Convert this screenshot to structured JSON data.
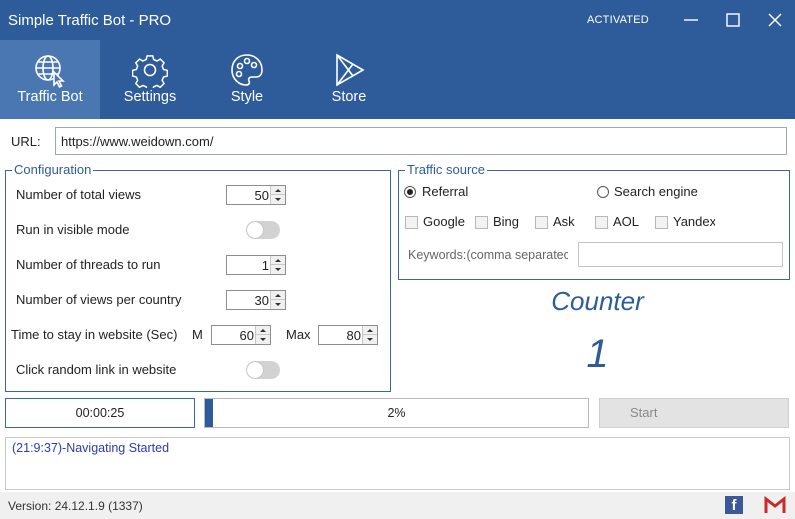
{
  "window": {
    "title": "Simple Traffic Bot - PRO",
    "status": "ACTIVATED",
    "controls": [
      "minimize-icon",
      "maximize-icon",
      "close-icon"
    ]
  },
  "nav": {
    "tabs": [
      {
        "label": "Traffic Bot",
        "icon": "globe-cursor-icon",
        "active": true
      },
      {
        "label": "Settings",
        "icon": "gear-icon",
        "active": false
      },
      {
        "label": "Style",
        "icon": "palette-icon",
        "active": false
      },
      {
        "label": "Store",
        "icon": "play-store-icon",
        "active": false
      }
    ]
  },
  "url": {
    "label": "URL:",
    "value": "https://www.weidown.com/"
  },
  "configuration": {
    "title": "Configuration",
    "total_views": {
      "label": "Number of total views",
      "value": "50"
    },
    "visible_mode": {
      "label": "Run in visible mode",
      "on": false
    },
    "threads": {
      "label": "Number of threads to run",
      "value": "1"
    },
    "views_per_country": {
      "label": "Number of views per country",
      "value": "30"
    },
    "stay_time": {
      "label": "Time to stay in website (Sec)",
      "min_label": "M",
      "min_value": "60",
      "max_label": "Max",
      "max_value": "80"
    },
    "random_link": {
      "label": "Click random link in website",
      "on": false
    }
  },
  "traffic_source": {
    "title": "Traffic source",
    "referral": {
      "label": "Referral",
      "selected": true
    },
    "search_engine": {
      "label": "Search engine",
      "selected": false
    },
    "engines": [
      "Google",
      "Bing",
      "Ask",
      "AOL",
      "Yandeх"
    ],
    "keywords_label": "Keywords:(comma separatec",
    "keywords_value": ""
  },
  "counter": {
    "title": "Counter",
    "value": "1"
  },
  "run": {
    "timer": "00:00:25",
    "progress_text": "2%",
    "progress_fraction": 0.02,
    "start_label": "Start"
  },
  "log": {
    "lines": [
      "(21:9:37)-Navigating Started"
    ]
  },
  "footer": {
    "version": "Version: 24.12.1.9 (1337)",
    "facebook_icon_text": "f"
  },
  "colors": {
    "brand": "#2e5c9a",
    "active_tab": "#4a77b2",
    "log_text": "#2a3bb3"
  }
}
